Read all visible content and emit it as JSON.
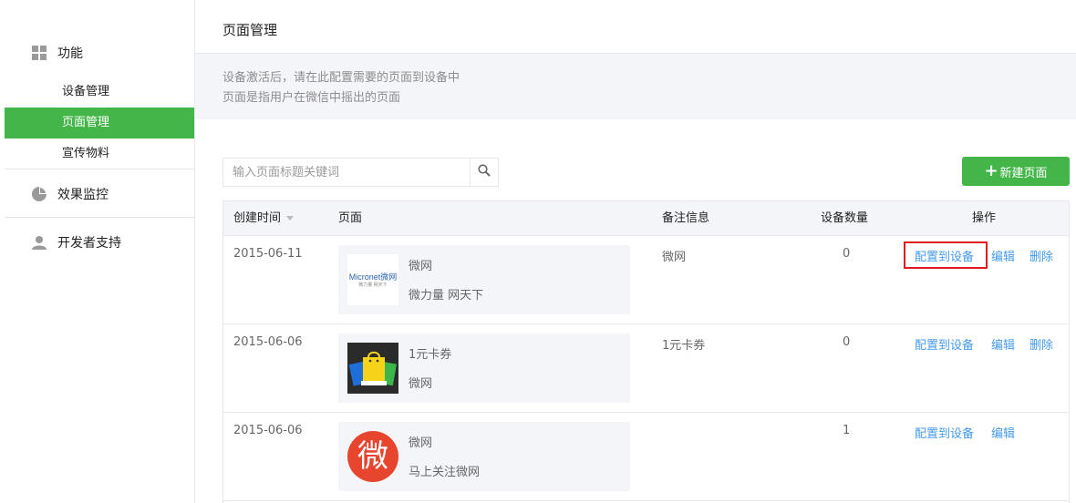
{
  "sidebar": {
    "sections": [
      {
        "label": "功能",
        "icon": "grid-icon",
        "items": [
          {
            "label": "设备管理",
            "active": false
          },
          {
            "label": "页面管理",
            "active": true
          },
          {
            "label": "宣传物料",
            "active": false
          }
        ]
      },
      {
        "label": "效果监控",
        "icon": "pie-chart-icon"
      },
      {
        "label": "开发者支持",
        "icon": "person-icon"
      }
    ]
  },
  "main": {
    "title": "页面管理",
    "tips": [
      "设备激活后，请在此配置需要的页面到设备中",
      "页面是指用户在微信中摇出的页面"
    ],
    "search": {
      "placeholder": "输入页面标题关键词",
      "value": ""
    },
    "new_button": {
      "icon": "+",
      "label": "新建页面"
    }
  },
  "table": {
    "headers": {
      "date": "创建时间",
      "page": "页面",
      "note": "备注信息",
      "count": "设备数量",
      "actions": "操作"
    },
    "rows": [
      {
        "date": "2015-06-11",
        "thumb": "micronet-logo",
        "thumb_text": "Micronet微网",
        "thumb_sub": "微力量 网天下",
        "title": "微网",
        "desc": "微力量 网天下",
        "note": "微网",
        "count": "0",
        "actions": {
          "config": "配置到设备",
          "edit": "编辑",
          "delete": "删除"
        },
        "highlighted": true
      },
      {
        "date": "2015-06-06",
        "thumb": "shopping-bag-image",
        "title": "1元卡券",
        "desc": "微网",
        "note": "1元卡券",
        "count": "0",
        "actions": {
          "config": "配置到设备",
          "edit": "编辑",
          "delete": "删除"
        },
        "highlighted": false
      },
      {
        "date": "2015-06-06",
        "thumb": "wei-circle-logo",
        "thumb_text": "微",
        "title": "微网",
        "desc": "马上关注微网",
        "note": "",
        "count": "1",
        "actions": {
          "config": "配置到设备",
          "edit": "编辑"
        },
        "highlighted": false
      }
    ]
  },
  "colors": {
    "accent": "#44b549",
    "link": "#459ae9",
    "highlight_border": "#e0191b",
    "panel_bg": "#f4f5f9"
  }
}
